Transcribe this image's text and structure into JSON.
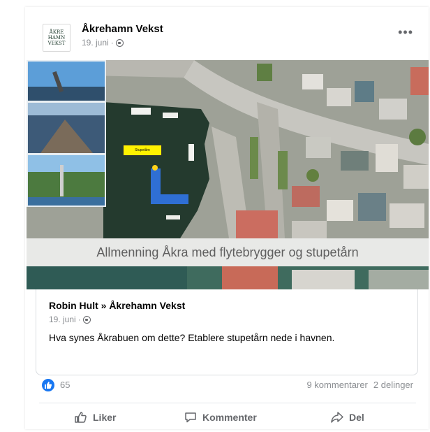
{
  "post": {
    "page_name": "Åkrehamn Vekst",
    "date": "19. juni",
    "dot": "·",
    "avatar_lines": [
      "ÅKRE",
      "HAMN",
      "VEKST"
    ]
  },
  "image": {
    "caption": "Allmenning Åkra med flytebrygger og stupetårn",
    "map_label": "Stupetårn"
  },
  "shared": {
    "author": "Robin Hult » Åkrehamn Vekst",
    "date": "19. juni",
    "dot": "·",
    "text": "Hva synes Åkrabuen om dette? Etablere stupetårn nede i havnen."
  },
  "stats": {
    "likes": "65",
    "comments": "9 kommentarer",
    "shares": "2 delinger"
  },
  "actions": {
    "like": "Liker",
    "comment": "Kommenter",
    "share": "Del"
  },
  "colors": {
    "accent": "#1877f2",
    "muted_text": "#65676b",
    "meta_text": "#8a8d91",
    "label_yellow": "#fff200",
    "dock_blue": "#2f6fd4"
  },
  "icons": {
    "more": "more-icon",
    "globe": "globe-icon",
    "like": "thumbs-up-icon",
    "comment": "comment-icon",
    "share": "share-icon"
  }
}
